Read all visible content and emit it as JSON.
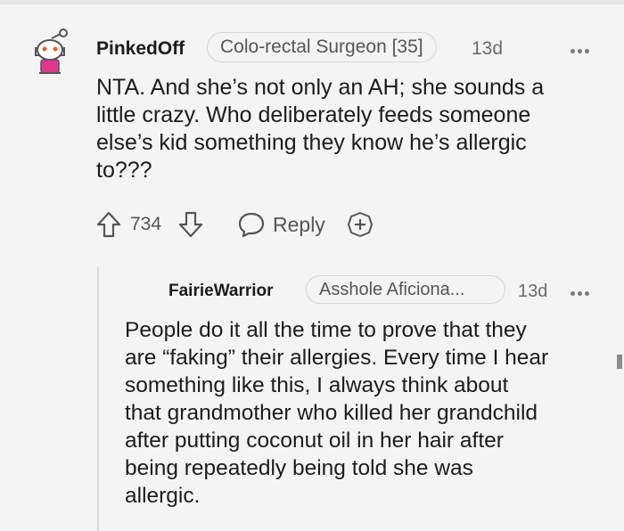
{
  "comment": {
    "username": "PinkedOff",
    "flair": "Colo-rectal Surgeon [35]",
    "age": "13d",
    "text_lines": [
      "NTA. And she’s not only an AH; she sounds a",
      "little crazy. Who deliberately feeds someone",
      "else’s kid something they know he’s allergic",
      "to???"
    ],
    "votes": "734",
    "reply_label": "Reply"
  },
  "reply": {
    "username": "FairieWarrior",
    "flair": "Asshole Aficiona...",
    "age": "13d",
    "text_lines": [
      "People do it all the time to prove that they",
      "are “faking” their allergies. Every time I hear",
      "something like this, I always think about",
      "that grandmother who killed her grandchild",
      "after putting coconut oil in her hair after",
      "being repeatedly being told she was",
      "allergic."
    ]
  },
  "colors": {
    "background": "#f4f4f4",
    "avatar_accent": "#e0398f",
    "icon": "#555555"
  },
  "icons": [
    "snoo-avatar-icon",
    "upvote-icon",
    "downvote-icon",
    "reply-icon",
    "award-icon",
    "more-options-icon"
  ]
}
